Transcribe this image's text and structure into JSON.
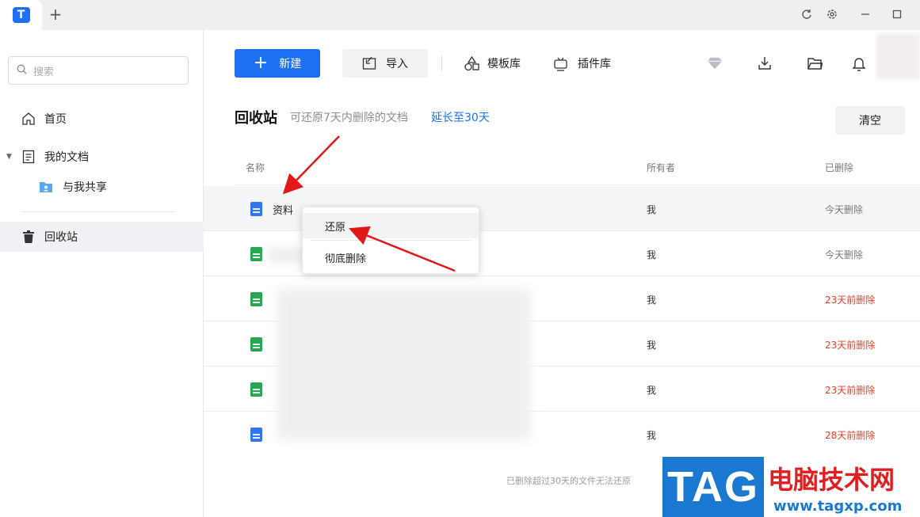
{
  "titlebar": {
    "logo_text": "T",
    "new_tab": "+",
    "controls": [
      "refresh-icon",
      "settings-icon",
      "minimize-icon",
      "maximize-icon"
    ]
  },
  "sidebar": {
    "search_placeholder": "搜索",
    "items": [
      {
        "label": "首页",
        "icon": "home-icon"
      },
      {
        "label": "我的文档",
        "icon": "document-icon"
      },
      {
        "label": "与我共享",
        "icon": "shared-folder-icon"
      },
      {
        "label": "回收站",
        "icon": "trash-icon"
      }
    ]
  },
  "toolbar": {
    "new_label": "新建",
    "import_label": "导入",
    "templates_label": "模板库",
    "plugins_label": "插件库",
    "icons": [
      "diamond-icon",
      "download-icon",
      "folder-icon",
      "bell-icon"
    ]
  },
  "page": {
    "title": "回收站",
    "subtitle": "可还原7天内删除的文档",
    "extend_link": "延长至30天",
    "clear_button": "清空"
  },
  "table": {
    "headers": {
      "name": "名称",
      "owner": "所有者",
      "deleted": "已删除"
    },
    "rows": [
      {
        "name": "资料",
        "type": "doc",
        "owner": "我",
        "deleted": "今天删除",
        "color": "#777777"
      },
      {
        "name": "",
        "type": "sheet",
        "owner": "我",
        "deleted": "今天删除",
        "color": "#777777"
      },
      {
        "name": "",
        "type": "sheet",
        "owner": "我",
        "deleted": "23天前删除",
        "color": "#e0402b"
      },
      {
        "name": "",
        "type": "sheet",
        "owner": "我",
        "deleted": "23天前删除",
        "color": "#e0402b"
      },
      {
        "name": "",
        "type": "sheet",
        "owner": "我",
        "deleted": "23天前删除",
        "color": "#e0402b"
      },
      {
        "name": "",
        "type": "doc",
        "owner": "我",
        "deleted": "28天前删除",
        "color": "#e0402b"
      }
    ]
  },
  "context_menu": {
    "restore": "还原",
    "delete_forever": "彻底删除"
  },
  "footnote": "已删除超过30天的文件无法还原",
  "watermark": {
    "tag": "TAG",
    "title": "电脑技术网",
    "url": "www.tagxp.com"
  },
  "colors": {
    "accent": "#1e6ff1",
    "danger": "#e0402b",
    "arrow": "#e01818"
  }
}
